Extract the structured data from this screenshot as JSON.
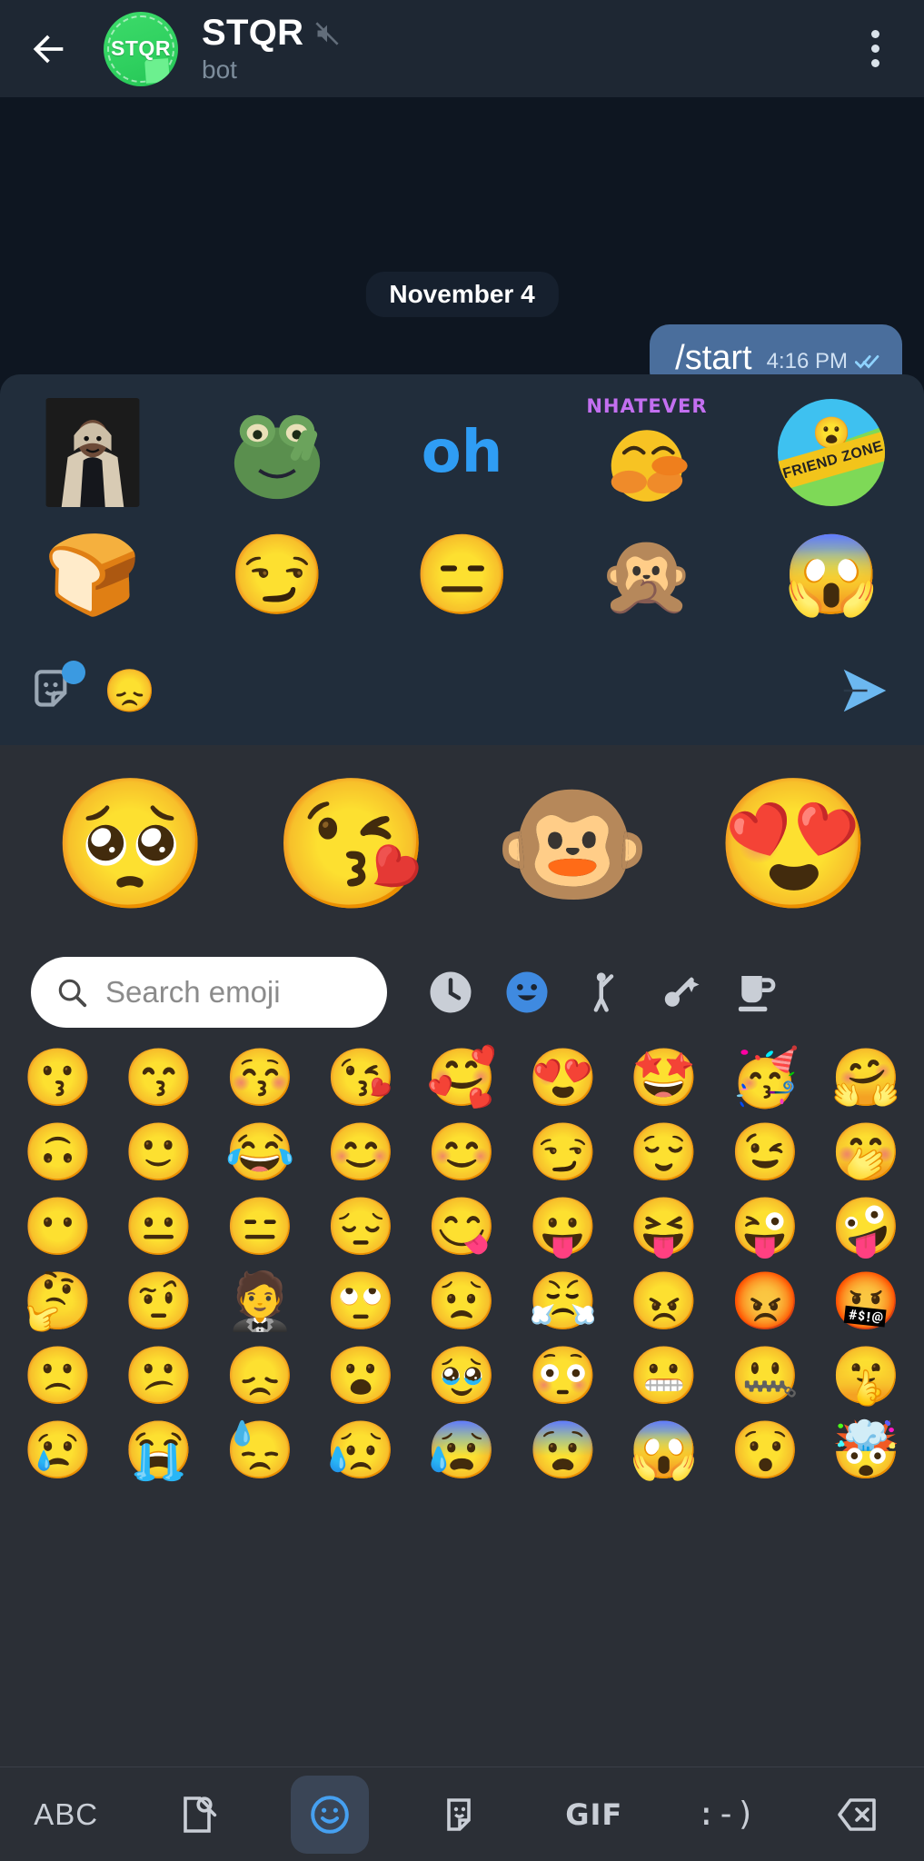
{
  "header": {
    "title": "STQR",
    "subtitle": "bot",
    "avatar_text": "STQR",
    "back_icon": "back-arrow-icon",
    "mute_icon": "muted-speaker-icon",
    "menu_icon": "more-options-icon",
    "accent_green": "#2fd05f"
  },
  "chat": {
    "date_badge": "November 4",
    "message": {
      "text": "/start",
      "time": "4:16 PM",
      "status_icon": "double-check-icon",
      "bubble_color": "#4a6e9c"
    }
  },
  "sticker_panel": {
    "row1": [
      {
        "name": "sticker-man-photo",
        "kind": "photo",
        "label": ""
      },
      {
        "name": "sticker-frog-peace",
        "kind": "emoji",
        "label": "🐸"
      },
      {
        "name": "sticker-oh-text",
        "kind": "text",
        "label": "oh"
      },
      {
        "name": "sticker-duck-whatever",
        "kind": "whatever",
        "label": "NHATEVER"
      },
      {
        "name": "sticker-friend-zone",
        "kind": "friendzone",
        "label": "FRIEND ZONE"
      }
    ],
    "row2": [
      {
        "name": "sticker-pink-toast",
        "label": "🍞"
      },
      {
        "name": "sticker-yellow-smug",
        "label": "😏"
      },
      {
        "name": "sticker-blue-monster",
        "label": "😑"
      },
      {
        "name": "sticker-monkey-speak-no-evil",
        "label": "🙊"
      },
      {
        "name": "sticker-red-dog-shock",
        "label": "😱"
      }
    ]
  },
  "input_bar": {
    "sticker_icon": "sticker-picker-icon",
    "badge": "new-stickers-dot",
    "typed_text": "😞",
    "send_icon": "send-icon",
    "send_color": "#6cb8f0"
  },
  "keyboard": {
    "suggestions": [
      {
        "name": "suggestion-pleading-face",
        "glyph": "🥺"
      },
      {
        "name": "suggestion-kissing-heart",
        "glyph": "😘"
      },
      {
        "name": "suggestion-monkey-face",
        "glyph": "🐵"
      },
      {
        "name": "suggestion-heart-eyes",
        "glyph": "😍"
      }
    ],
    "search": {
      "placeholder": "Search emoji",
      "value": "",
      "icon": "search-icon"
    },
    "categories": [
      {
        "name": "category-recent",
        "icon": "clock-icon",
        "active": false
      },
      {
        "name": "category-smileys",
        "icon": "smiley-icon",
        "active": true
      },
      {
        "name": "category-people",
        "icon": "person-icon",
        "active": false
      },
      {
        "name": "category-animals-nature",
        "icon": "animals-nature-icon",
        "active": false
      },
      {
        "name": "category-food-drink",
        "icon": "food-drink-icon",
        "active": false
      }
    ],
    "grid_rows": [
      [
        "😗",
        "😙",
        "😚",
        "😘",
        "🥰",
        "😍",
        "🤩",
        "🥳",
        "🤗"
      ],
      [
        "🙃",
        "🙂",
        "😂",
        "😊",
        "😊",
        "😏",
        "😌",
        "😉",
        "🤭"
      ],
      [
        "😶",
        "😐",
        "😑",
        "😔",
        "😋",
        "😛",
        "😝",
        "😜",
        "🤪"
      ],
      [
        "🤔",
        "🤨",
        "🤵",
        "🙄",
        "😟",
        "😤",
        "😠",
        "😡",
        "🤬"
      ],
      [
        "🙁",
        "😕",
        "😞",
        "😮",
        "🥹",
        "😳",
        "😬",
        "🤐",
        "🤫"
      ],
      [
        "😢",
        "😭",
        "😓",
        "😥",
        "😰",
        "😨",
        "😱",
        "😯",
        "🤯"
      ]
    ]
  },
  "toolbar": {
    "items": [
      {
        "name": "toolbar-abc-button",
        "label": "ABC",
        "kind": "text",
        "active": false
      },
      {
        "name": "toolbar-search-button",
        "label": "",
        "kind": "search",
        "active": false
      },
      {
        "name": "toolbar-emoji-button",
        "label": "",
        "kind": "emoji",
        "active": true
      },
      {
        "name": "toolbar-sticker-button",
        "label": "",
        "kind": "sticker",
        "active": false
      },
      {
        "name": "toolbar-gif-button",
        "label": "GIF",
        "kind": "gif",
        "active": false
      },
      {
        "name": "toolbar-kaomoji-button",
        "label": ":-)",
        "kind": "kaomoji",
        "active": false
      },
      {
        "name": "toolbar-backspace-button",
        "label": "",
        "kind": "backspace",
        "active": false
      }
    ]
  }
}
